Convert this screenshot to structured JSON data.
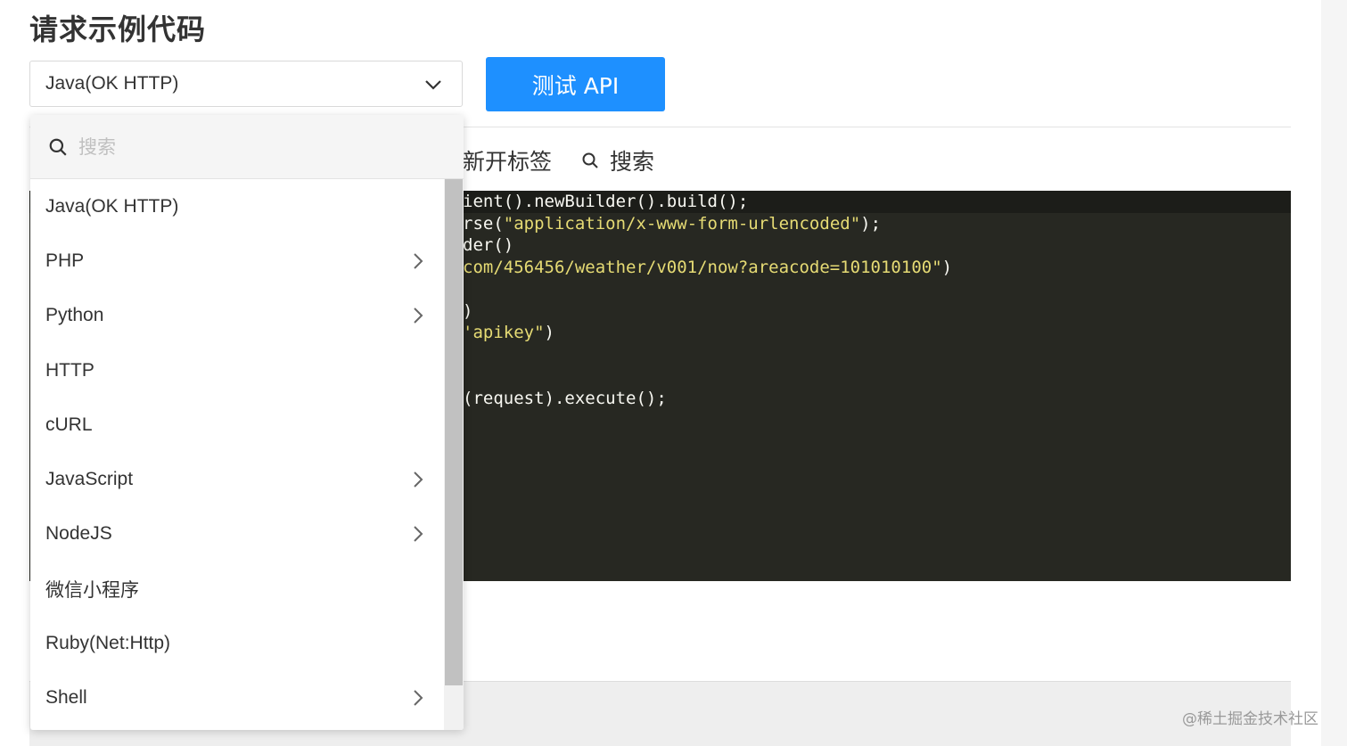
{
  "page": {
    "title": "请求示例代码"
  },
  "language_select": {
    "selected": "Java(OK HTTP)",
    "icon": "chevron-down-icon"
  },
  "test_button": {
    "label": "测试 API",
    "color": "#1e90ff"
  },
  "toolbar": {
    "new_tab": "新开标签",
    "search": "搜索"
  },
  "code": {
    "background": "#272822",
    "lines": [
      {
        "plain": "ient().newBuilder().build();",
        "str": "",
        "tail": ""
      },
      {
        "plain": "rse(",
        "str": "\"application/x-www-form-urlencoded\"",
        "tail": ");"
      },
      {
        "plain": "der()",
        "str": "",
        "tail": ""
      },
      {
        "plain": "",
        "str": "com/456456/weather/v001/now?areacode=101010100\"",
        "tail": ")"
      },
      {
        "plain": "",
        "str": "",
        "tail": ""
      },
      {
        "plain": ")",
        "str": "",
        "tail": ""
      },
      {
        "plain": "",
        "str": "'apikey\"",
        "tail": ")"
      },
      {
        "plain": "",
        "str": "",
        "tail": ""
      },
      {
        "plain": "",
        "str": "",
        "tail": ""
      },
      {
        "plain": "(request).execute();",
        "str": "",
        "tail": ""
      }
    ]
  },
  "dropdown": {
    "search_placeholder": "搜索",
    "items": [
      {
        "label": "Java(OK HTTP)",
        "has_submenu": false
      },
      {
        "label": "PHP",
        "has_submenu": true
      },
      {
        "label": "Python",
        "has_submenu": true
      },
      {
        "label": "HTTP",
        "has_submenu": false
      },
      {
        "label": "cURL",
        "has_submenu": false
      },
      {
        "label": "JavaScript",
        "has_submenu": true
      },
      {
        "label": "NodeJS",
        "has_submenu": true
      },
      {
        "label": "微信小程序",
        "has_submenu": false
      },
      {
        "label": "Ruby(Net:Http)",
        "has_submenu": false
      },
      {
        "label": "Shell",
        "has_submenu": true
      }
    ]
  },
  "watermark": "@稀土掘金技术社区"
}
